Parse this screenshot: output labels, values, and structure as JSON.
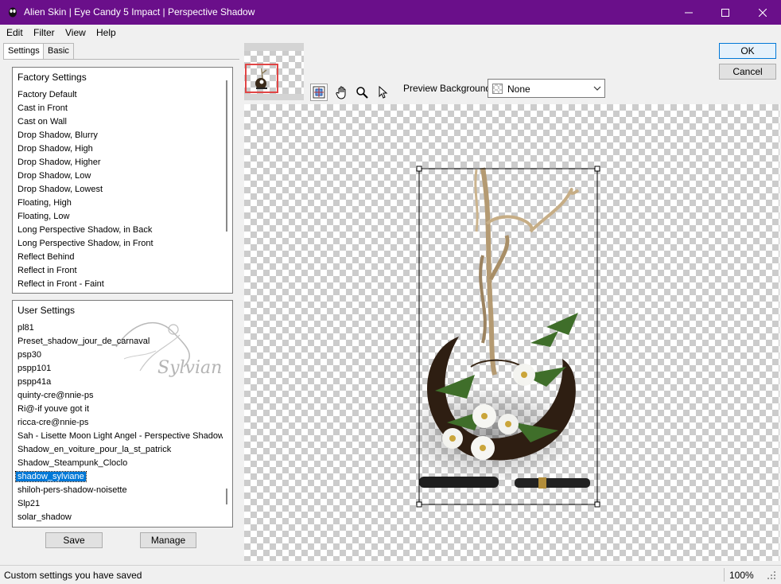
{
  "window": {
    "title": "Alien Skin | Eye Candy 5 Impact | Perspective Shadow"
  },
  "menu": [
    "Edit",
    "Filter",
    "View",
    "Help"
  ],
  "tabs": [
    "Settings",
    "Basic"
  ],
  "factory": {
    "header": "Factory Settings",
    "items": [
      "Factory Default",
      "Cast in Front",
      "Cast on Wall",
      "Drop Shadow, Blurry",
      "Drop Shadow, High",
      "Drop Shadow, Higher",
      "Drop Shadow, Low",
      "Drop Shadow, Lowest",
      "Floating, High",
      "Floating, Low",
      "Long Perspective Shadow, in Back",
      "Long Perspective Shadow, in Front",
      "Reflect Behind",
      "Reflect in Front",
      "Reflect in Front - Faint"
    ]
  },
  "user": {
    "header": "User Settings",
    "items": [
      "pl81",
      "Preset_shadow_jour_de_carnaval",
      "psp30",
      "pspp101",
      "pspp41a",
      "quinty-cre@nnie-ps",
      "Ri@-if youve got it",
      "ricca-cre@nnie-ps",
      "Sah - Lisette Moon Light Angel - Perspective Shadow",
      "Shadow_en_voiture_pour_la_st_patrick",
      "Shadow_Steampunk_Cloclo",
      "shadow_sylviane",
      "shiloh-pers-shadow-noisette",
      "Slp21",
      "solar_shadow"
    ],
    "selected": "shadow_sylviane"
  },
  "watermark": "Sylviane",
  "buttons": {
    "save": "Save",
    "manage": "Manage",
    "ok": "OK",
    "cancel": "Cancel"
  },
  "preview_background": {
    "label": "Preview Background:",
    "value": "None"
  },
  "status": {
    "text": "Custom settings you have saved",
    "zoom": "100%"
  },
  "icons": [
    "app-icon",
    "minimize-icon",
    "maximize-icon",
    "close-icon",
    "navigate-tool-icon",
    "hand-tool-icon",
    "zoom-tool-icon",
    "pointer-tool-icon",
    "chevron-down-icon",
    "resize-grip-icon"
  ],
  "colors": {
    "titlebar": "#6a0f8a",
    "selection": "#0078d7",
    "navigator_frame": "#e04545"
  }
}
